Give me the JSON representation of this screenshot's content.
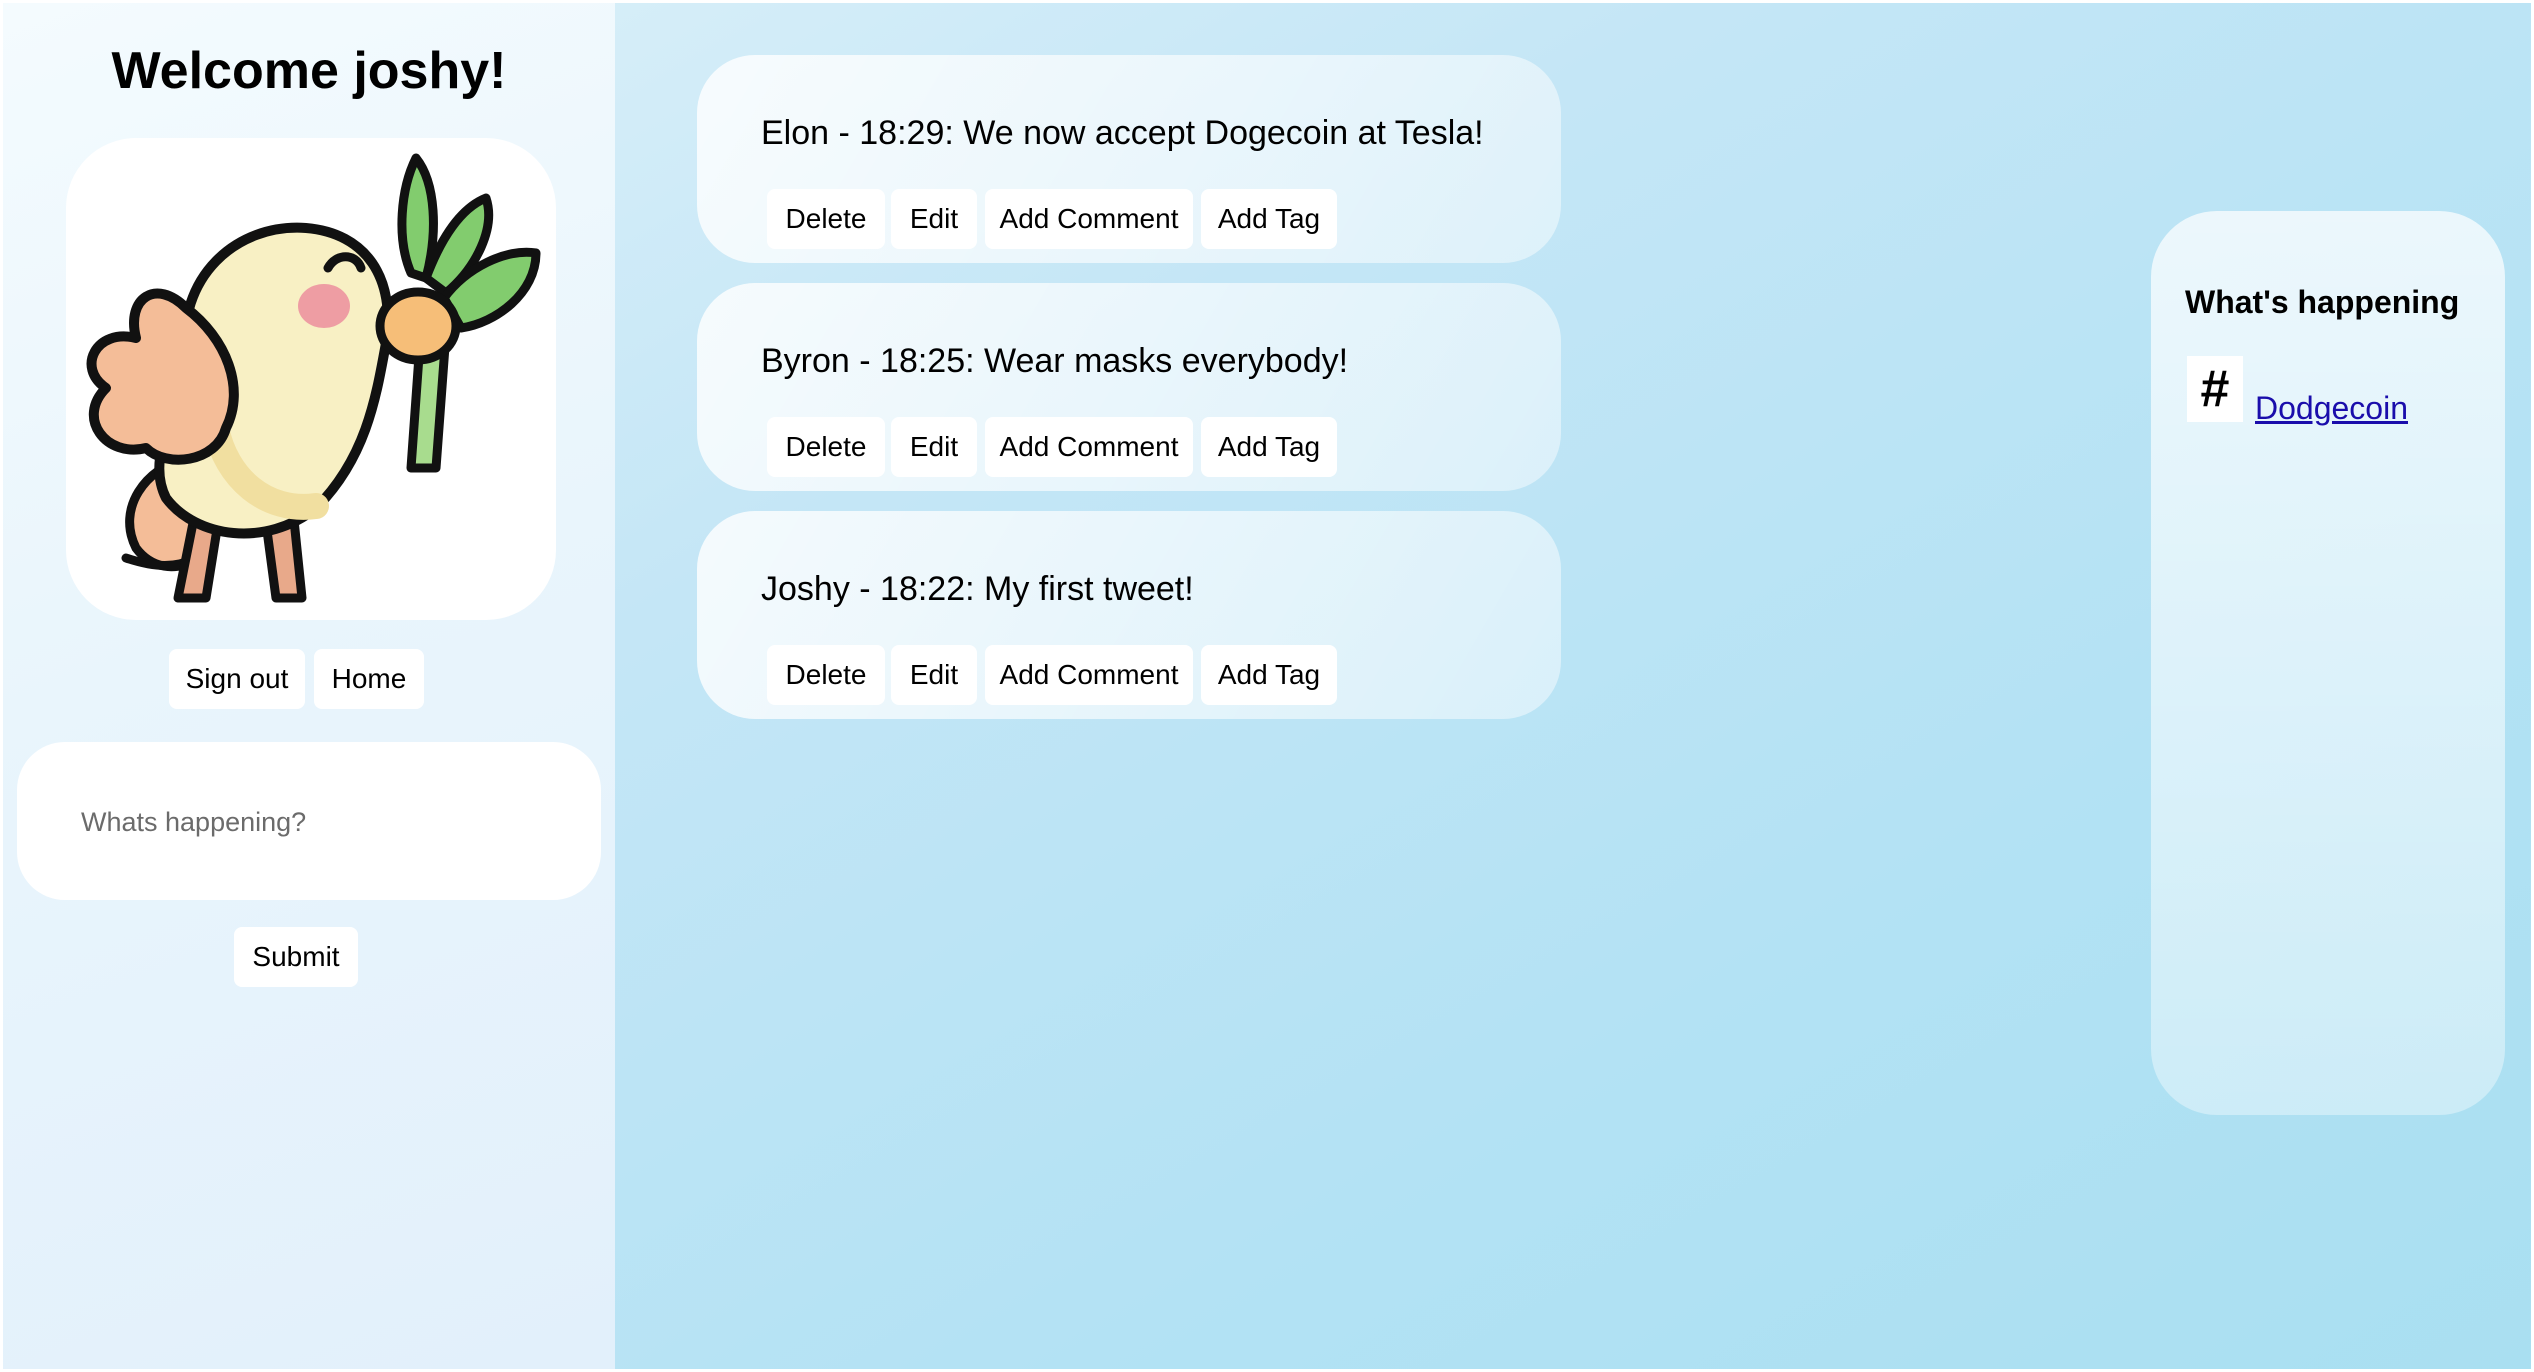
{
  "user": {
    "welcome": "Welcome joshy!"
  },
  "nav": {
    "sign_out": "Sign out",
    "home": "Home"
  },
  "composer": {
    "placeholder": "Whats happening?",
    "submit": "Submit"
  },
  "tweet_actions": {
    "delete": "Delete",
    "edit": "Edit",
    "add_comment": "Add Comment",
    "add_tag": "Add Tag"
  },
  "tweets": [
    {
      "text": "Elon - 18:29: We now accept Dogecoin at Tesla!"
    },
    {
      "text": "Byron - 18:25: Wear masks everybody!"
    },
    {
      "text": "Joshy - 18:22: My first tweet!"
    }
  ],
  "trending": {
    "heading": "What's happening",
    "icon": "hashtag-icon",
    "icon_glyph": "#",
    "items": [
      {
        "label": "Dodgecoin"
      }
    ]
  },
  "colors": {
    "background_gradient": [
      "#dff2fa",
      "#a9dff1"
    ],
    "left_panel": "#eaf5fc",
    "link": "#1a0dab",
    "button_bg": "#ffffff"
  },
  "avatar": {
    "icon": "bird-with-leek-icon"
  }
}
